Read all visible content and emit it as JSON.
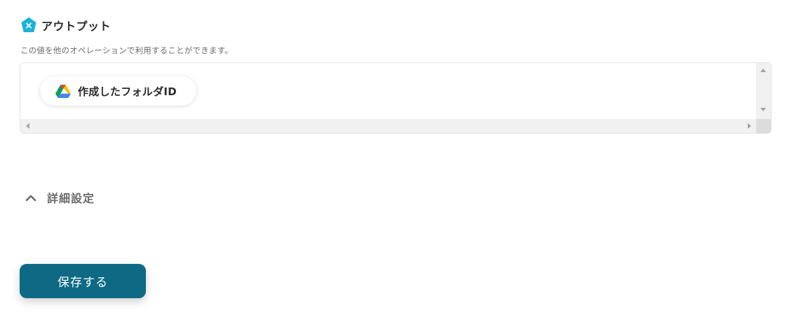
{
  "output": {
    "title": "アウトプット",
    "description": "この値を他のオペレーションで利用することができます。",
    "chip_label": "作成したフォルダID"
  },
  "advanced": {
    "label": "詳細設定"
  },
  "footer": {
    "save_label": "保存する"
  },
  "colors": {
    "accent": "#0e6a84",
    "output_icon": "#1bb3d9"
  },
  "icons": {
    "output": "x-badge-icon",
    "chip": "google-drive-icon",
    "advanced": "chevron-up-icon"
  }
}
